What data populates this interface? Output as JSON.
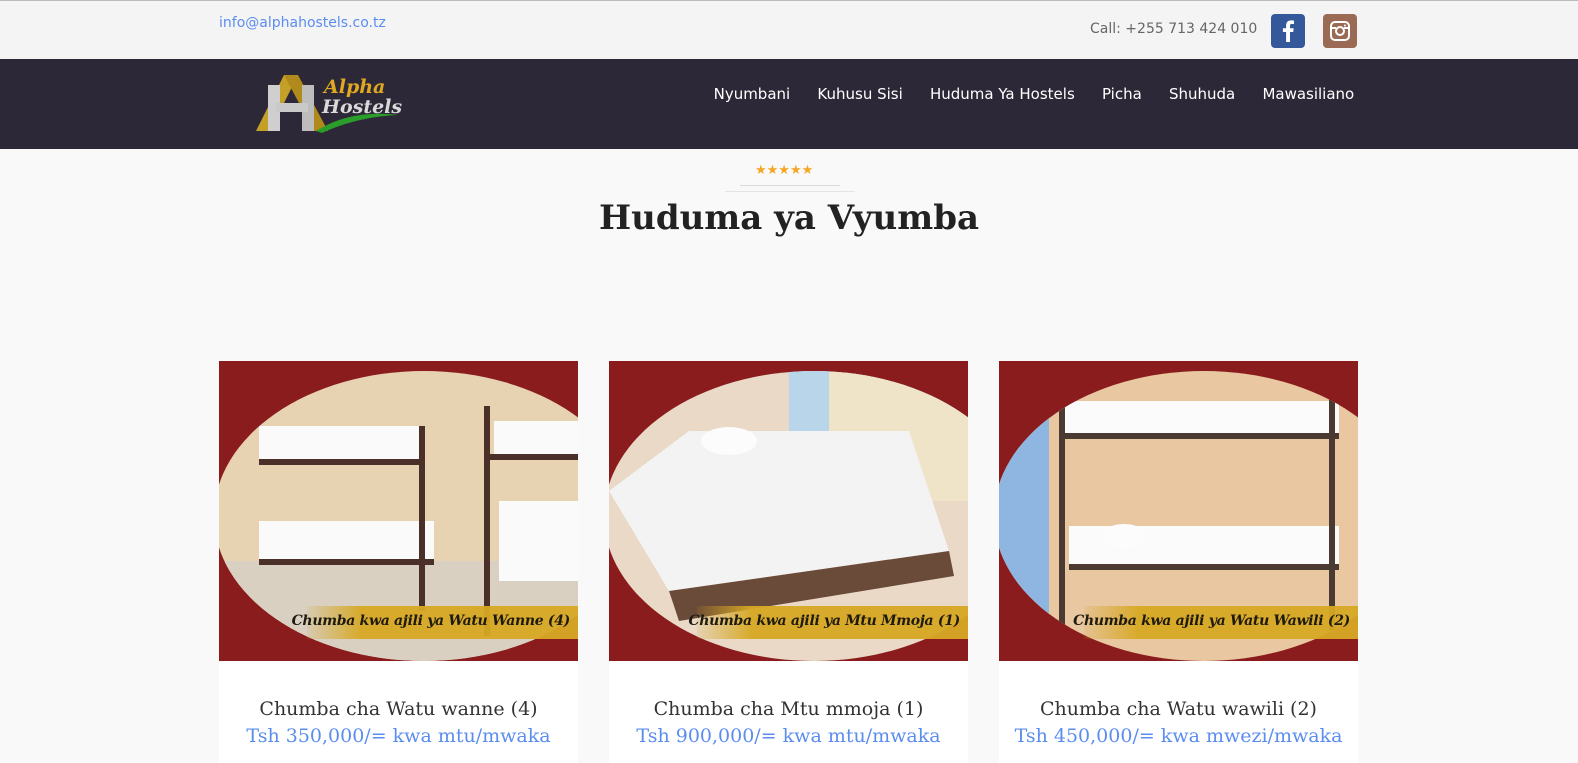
{
  "topbar": {
    "email": "info@alphahostels.co.tz",
    "phone": "Call: +255 713 424 010",
    "social": [
      {
        "icon": "facebook-icon"
      },
      {
        "icon": "instagram-icon"
      }
    ]
  },
  "brand": {
    "line1": "Alpha",
    "line2": "Hostels"
  },
  "nav": [
    "Nyumbani",
    "Kuhusu Sisi",
    "Huduma Ya Hostels",
    "Picha",
    "Shuhuda",
    "Mawasiliano"
  ],
  "section": {
    "rating_stars": "★★★★★",
    "title": "Huduma ya Vyumba"
  },
  "rooms": [
    {
      "caption": "Chumba kwa ajili ya Watu Wanne (4)",
      "title": "Chumba cha Watu wanne (4)",
      "price": "Tsh 350,000/= kwa mtu/mwaka"
    },
    {
      "caption": "Chumba kwa ajili ya Mtu Mmoja (1)",
      "title": "Chumba cha Mtu mmoja (1)",
      "price": "Tsh 900,000/= kwa mtu/mwaka"
    },
    {
      "caption": "Chumba kwa ajili ya Watu Wawili (2)",
      "title": "Chumba cha Watu wawili (2)",
      "price": "Tsh 450,000/= kwa mwezi/mwaka"
    }
  ],
  "colors": {
    "nav_bg": "#2d2837",
    "accent": "#5b8def",
    "gold": "#d7a823",
    "card_red": "#8a1c1e"
  }
}
